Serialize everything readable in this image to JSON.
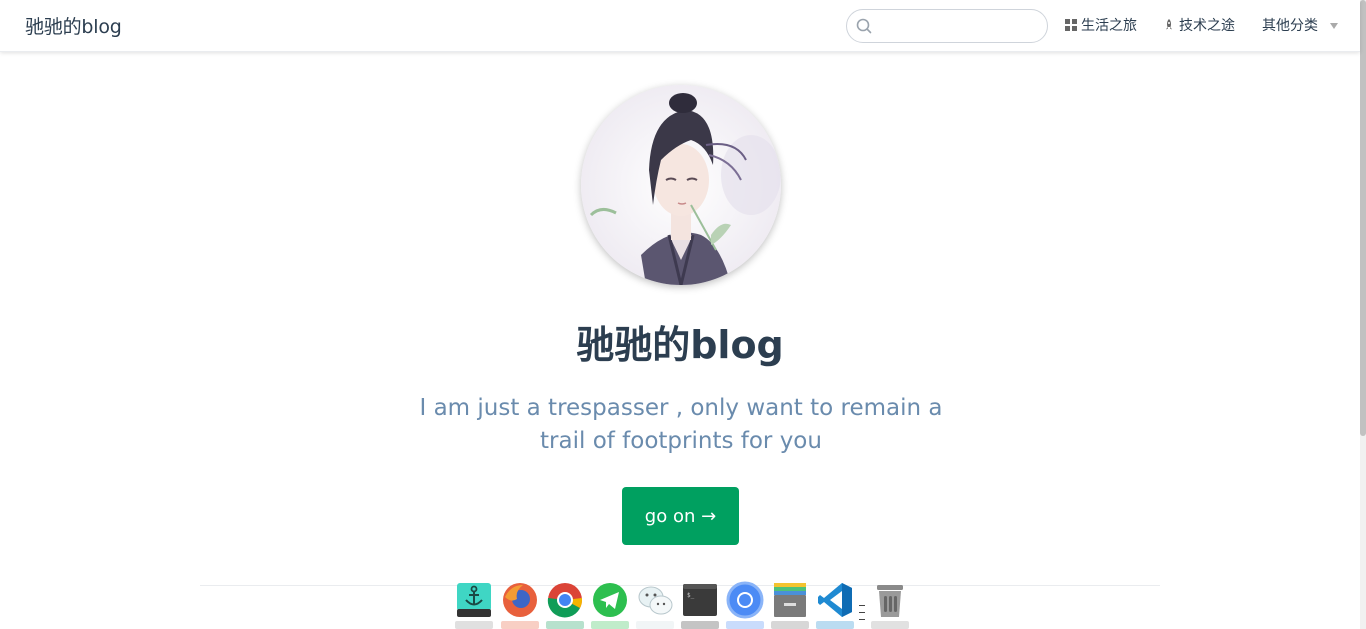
{
  "navbar": {
    "site_name": "驰驰的blog",
    "search": {
      "placeholder": "",
      "value": ""
    },
    "items": [
      {
        "label": "生活之旅",
        "icon": "grid-icon"
      },
      {
        "label": "技术之途",
        "icon": "rocket-icon"
      },
      {
        "label": "其他分类",
        "icon": "caret-down-icon"
      }
    ]
  },
  "hero": {
    "title": "驰驰的blog",
    "description": "I am just a trespasser , only want to remain a trail of footprints for you",
    "action_label": "go on →"
  },
  "dock": {
    "apps": [
      {
        "name": "anchor-app-icon"
      },
      {
        "name": "firefox-icon"
      },
      {
        "name": "chrome-icon"
      },
      {
        "name": "telegram-icon"
      },
      {
        "name": "wechat-icon"
      },
      {
        "name": "terminal-icon"
      },
      {
        "name": "chromium-icon"
      },
      {
        "name": "archive-icon"
      },
      {
        "name": "vscode-icon"
      },
      {
        "name": "trash-icon"
      }
    ]
  },
  "colors": {
    "accent": "#00a060",
    "text": "#2c3e50",
    "description": "#6a8bad"
  }
}
